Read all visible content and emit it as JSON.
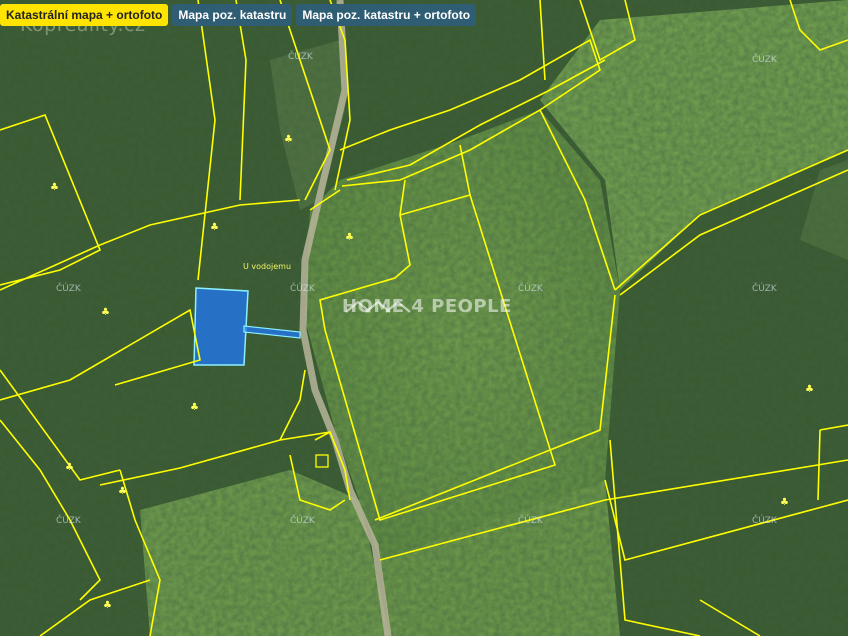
{
  "tabs": [
    {
      "label": "Katastrální mapa + ortofoto",
      "active": true
    },
    {
      "label": "Mapa poz. katastru",
      "active": false
    },
    {
      "label": "Mapa poz. katastru + ortofoto",
      "active": false
    }
  ],
  "map": {
    "watermark_top": "Kopreality.cz",
    "watermark_center": "HOME 4 PEOPLE",
    "provider_label": "ČÚZK",
    "place_label": "U vodojemu",
    "parcel_highlight_color": "#1e78ff",
    "parcel_border_color": "#ffff00"
  }
}
